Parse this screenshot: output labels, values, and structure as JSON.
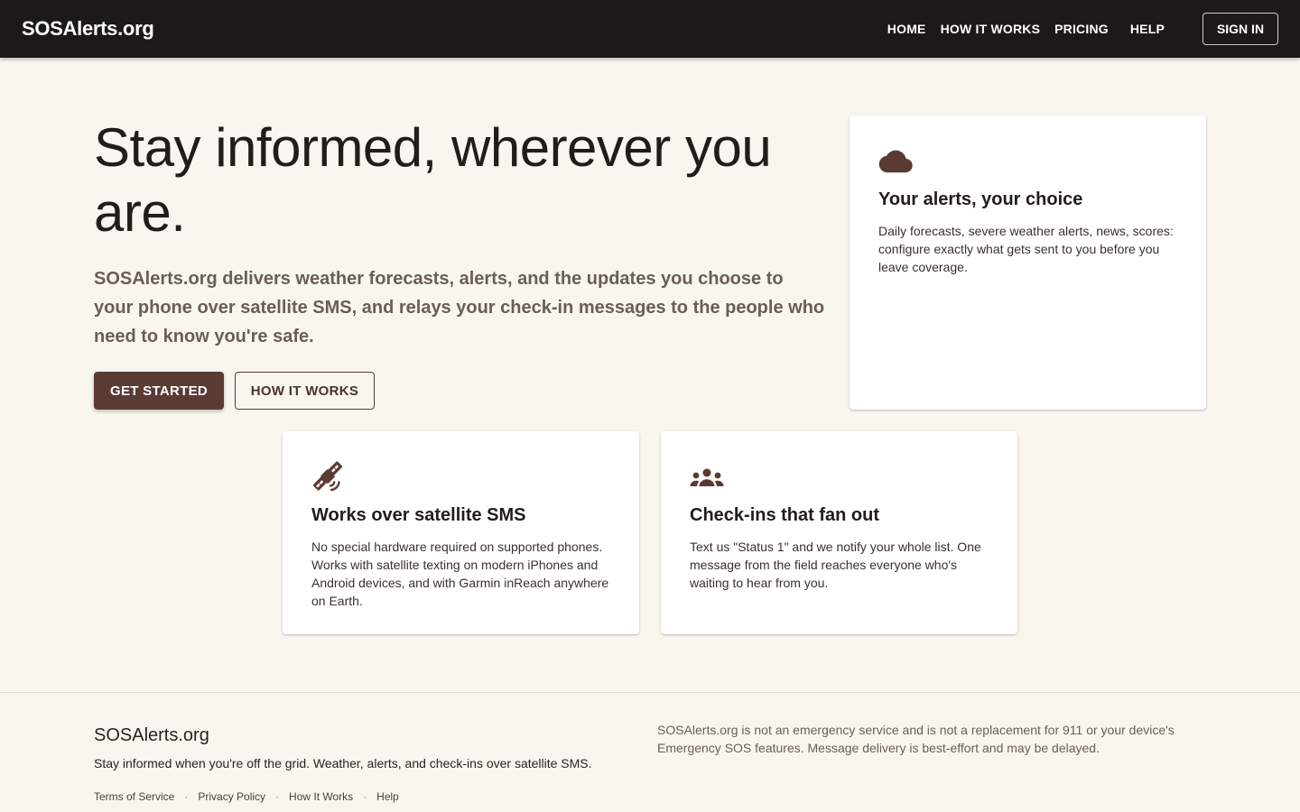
{
  "header": {
    "brand": "SOSAlerts.org",
    "nav": {
      "home": "HOME",
      "how_it_works": "HOW IT WORKS",
      "pricing": "PRICING",
      "help": "HELP"
    },
    "sign_in": "SIGN IN"
  },
  "hero": {
    "title": "Stay informed, wherever you are.",
    "subtitle": "SOSAlerts.org delivers weather forecasts, alerts, and the updates you choose to your phone over satellite SMS, and relays your check-in messages to the people who need to know you're safe.",
    "primary_cta": "GET STARTED",
    "secondary_cta": "HOW IT WORKS"
  },
  "features": {
    "alerts": {
      "icon": "cloud-icon",
      "title": "Your alerts, your choice",
      "text": "Daily forecasts, severe weather alerts, news, scores: configure exactly what gets sent to you before you leave coverage."
    },
    "satellite": {
      "icon": "satellite-icon",
      "title": "Works over satellite SMS",
      "text": "No special hardware required on supported phones. Works with satellite texting on modern iPhones and Android devices, and with Garmin inReach anywhere on Earth."
    },
    "checkins": {
      "icon": "group-icon",
      "title": "Check-ins that fan out",
      "text": "Text us \"Status 1\" and we notify your whole list. One message from the field reaches everyone who's waiting to hear from you."
    }
  },
  "footer": {
    "brand": "SOSAlerts.org",
    "tagline": "Stay informed when you're off the grid. Weather, alerts, and check-ins over satellite SMS.",
    "links": {
      "terms": "Terms of Service",
      "privacy": "Privacy Policy",
      "how": "How It Works",
      "help": "Help"
    },
    "separator": "·",
    "disclaimer": "SOSAlerts.org is not an emergency service and is not a replacement for 911 or your device's Emergency SOS features. Message delivery is best-effort and may be delayed."
  },
  "colors": {
    "header_bg": "#1c1a19",
    "page_bg": "#f9f6f0",
    "accent": "#5a3b33",
    "icon": "#5a3b33"
  }
}
